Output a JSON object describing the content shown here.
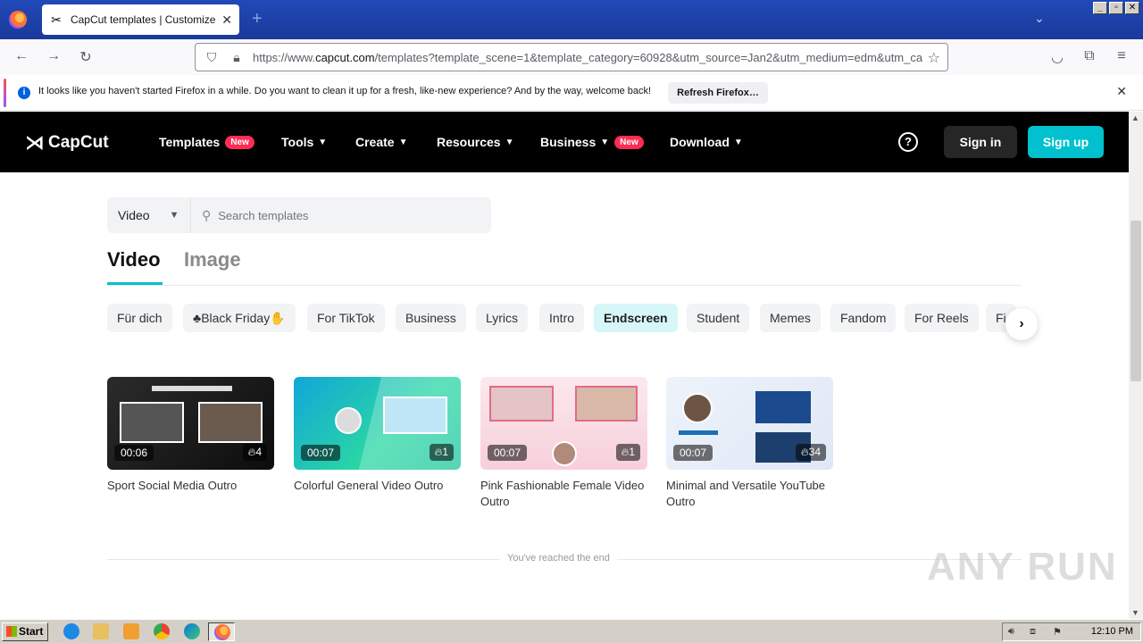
{
  "browser": {
    "tab_title": "CapCut templates | Customize your",
    "url_prefix": "https://www.",
    "url_domain": "capcut.com",
    "url_rest": "/templates?template_scene=1&template_category=60928&utm_source=Jan2&utm_medium=edm&utm_cam",
    "notification_text": "It looks like you haven't started Firefox in a while. Do you want to clean it up for a fresh, like-new experience? And by the way, welcome back!",
    "notification_button": "Refresh Firefox…"
  },
  "header": {
    "logo_text": "CapCut",
    "nav": [
      {
        "label": "Templates",
        "badge": "New"
      },
      {
        "label": "Tools"
      },
      {
        "label": "Create"
      },
      {
        "label": "Resources"
      },
      {
        "label": "Business",
        "badge": "New"
      },
      {
        "label": "Download"
      }
    ],
    "help": "?",
    "signin": "Sign in",
    "signup": "Sign up",
    "accent_color": "#00c1cd",
    "badge_color": "#fe2c55"
  },
  "search": {
    "type_label": "Video",
    "placeholder": "Search templates"
  },
  "media_tabs": [
    {
      "label": "Video",
      "active": true
    },
    {
      "label": "Image",
      "active": false
    }
  ],
  "chips": [
    "Für dich",
    "♣Black Friday✋",
    "For TikTok",
    "Business",
    "Lyrics",
    "Intro",
    "Endscreen",
    "Student",
    "Memes",
    "Fandom",
    "For Reels",
    "Fi"
  ],
  "selected_chip": "Endscreen",
  "templates": [
    {
      "title": "Sport Social Media Outro",
      "duration": "00:06",
      "uses": "4"
    },
    {
      "title": "Colorful General Video Outro",
      "duration": "00:07",
      "uses": "1"
    },
    {
      "title": "Pink Fashionable Female Video Outro",
      "duration": "00:07",
      "uses": "1"
    },
    {
      "title": "Minimal and Versatile YouTube Outro",
      "duration": "00:07",
      "uses": "34"
    }
  ],
  "end_text": "You've reached the end",
  "watermark": "ANY RUN",
  "taskbar": {
    "start_label": "Start",
    "clock": "12:10 PM"
  }
}
